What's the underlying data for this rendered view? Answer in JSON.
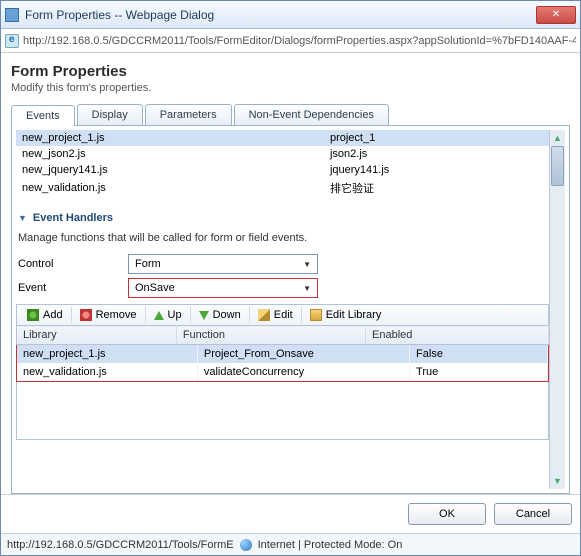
{
  "window": {
    "title": "Form Properties -- Webpage Dialog"
  },
  "addr": {
    "url": "http://192.168.0.5/GDCCRM2011/Tools/FormEditor/Dialogs/formProperties.aspx?appSolutionId=%7bFD140AAF-4DF4"
  },
  "header": {
    "title": "Form Properties",
    "subtitle": "Modify this form's properties."
  },
  "tabs": [
    "Events",
    "Display",
    "Parameters",
    "Non-Event Dependencies"
  ],
  "libraries": [
    {
      "name": "new_project_1.js",
      "display": "project_1",
      "selected": true
    },
    {
      "name": "new_json2.js",
      "display": "json2.js",
      "selected": false
    },
    {
      "name": "new_jquery141.js",
      "display": "jquery141.js",
      "selected": false
    },
    {
      "name": "new_validation.js",
      "display": "排它验证",
      "selected": false
    }
  ],
  "section": {
    "title": "Event Handlers",
    "desc": "Manage functions that will be called for form or field events."
  },
  "controls": {
    "control_label": "Control",
    "control_value": "Form",
    "event_label": "Event",
    "event_value": "OnSave"
  },
  "toolbar": {
    "add": "Add",
    "remove": "Remove",
    "up": "Up",
    "down": "Down",
    "edit": "Edit",
    "editlib": "Edit Library"
  },
  "grid": {
    "cols": [
      "Library",
      "Function",
      "Enabled"
    ],
    "rows": [
      {
        "lib": "new_project_1.js",
        "fn": "Project_From_Onsave",
        "en": "False"
      },
      {
        "lib": "new_validation.js",
        "fn": "validateConcurrency",
        "en": "True"
      }
    ]
  },
  "buttons": {
    "ok": "OK",
    "cancel": "Cancel"
  },
  "status": {
    "path": "http://192.168.0.5/GDCCRM2011/Tools/FormE",
    "zone": "Internet | Protected Mode: On"
  }
}
